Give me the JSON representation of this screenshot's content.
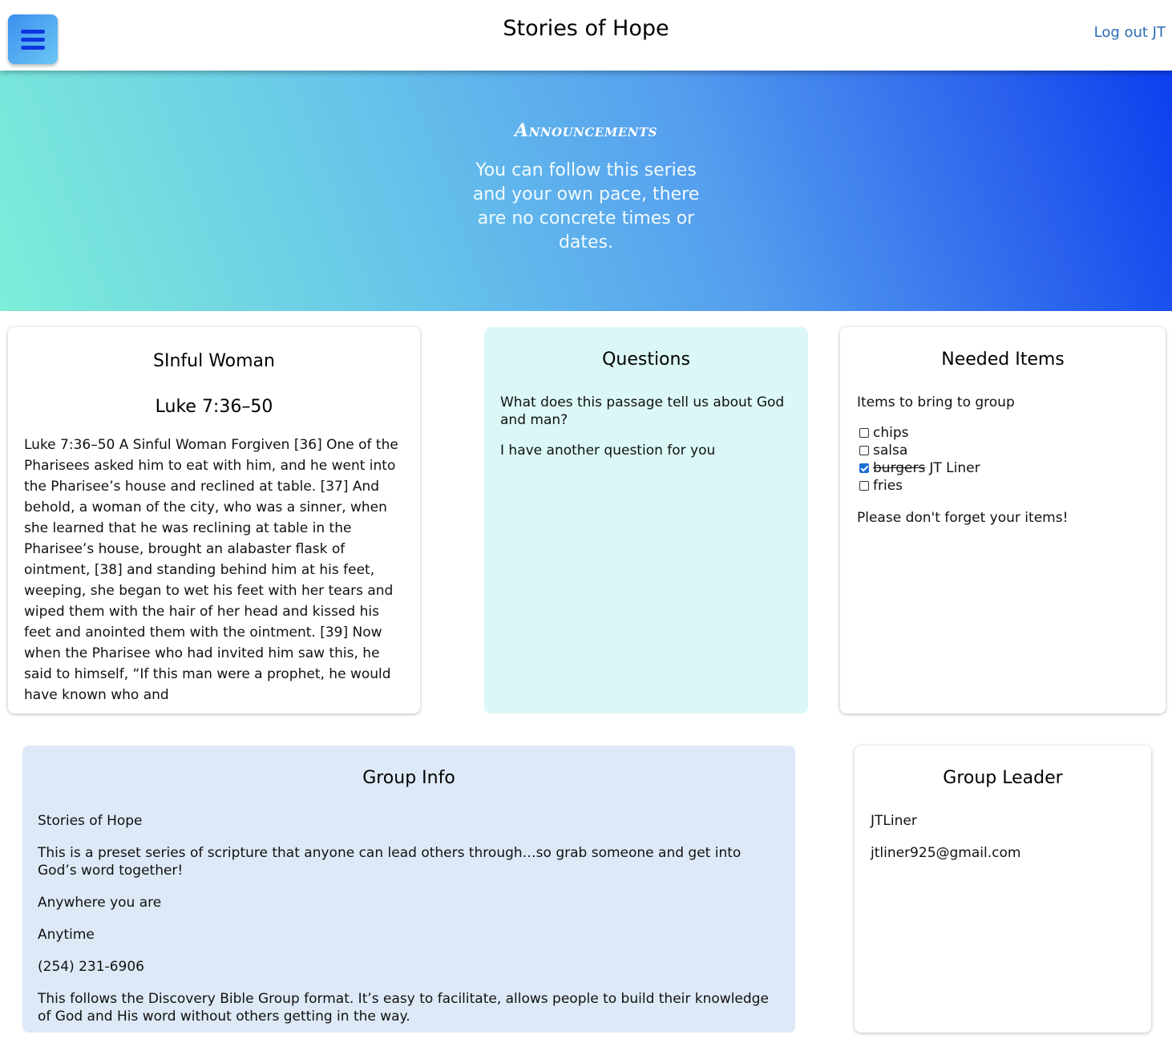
{
  "header": {
    "site_title": "Stories of Hope",
    "logout_label": "Log out JT",
    "menu_icon": "hamburger-menu-icon"
  },
  "announcements": {
    "title": "Announcements",
    "text": "You can follow this series and your own pace, there are no concrete times or dates."
  },
  "passage_card": {
    "title": "SInful Woman",
    "reference": "Luke 7:36–50",
    "text": "Luke 7:36–50 A Sinful Woman Forgiven [36] One of the Pharisees asked him to eat with him, and he went into the Pharisee’s house and reclined at table. [37] And behold, a woman of the city, who was a sinner, when she learned that he was reclining at table in the Pharisee’s house, brought an alabaster flask of ointment, [38] and standing behind him at his feet, weeping, she began to wet his feet with her tears and wiped them with the hair of her head and kissed his feet and anointed them with the ointment. [39] Now when the Pharisee who had invited him saw this, he said to himself, “If this man were a prophet, he would have known who and"
  },
  "questions_card": {
    "title": "Questions",
    "questions": [
      "What does this passage tell us about God and man?",
      "I have another question for you"
    ]
  },
  "needed_items_card": {
    "title": "Needed Items",
    "intro": "Items to bring to group",
    "items": [
      {
        "label": "chips",
        "checked": false,
        "taken_by": ""
      },
      {
        "label": "salsa",
        "checked": false,
        "taken_by": ""
      },
      {
        "label": "burgers",
        "checked": true,
        "taken_by": "JT Liner"
      },
      {
        "label": "fries",
        "checked": false,
        "taken_by": ""
      }
    ],
    "outro": "Please don't forget your items!"
  },
  "group_info_card": {
    "title": "Group Info",
    "name": "Stories of Hope",
    "description": "This is a preset series of scripture that anyone can lead others through…so grab someone and get into God’s word together!",
    "location": "Anywhere you are",
    "time": "Anytime",
    "phone": "(254) 231-6906",
    "format": "This follows the Discovery Bible Group format. It’s easy to facilitate, allows people to build their knowledge of God and His word without others getting in the way."
  },
  "group_leader_card": {
    "title": "Group Leader",
    "name": "JTLiner",
    "email": "jtliner925@gmail.com"
  },
  "colors": {
    "accent_link": "#2c6bb5",
    "questions_bg": "#dbf8f7",
    "group_info_bg": "#dde9f6",
    "checkbox_checked": "#1a6fd6"
  }
}
